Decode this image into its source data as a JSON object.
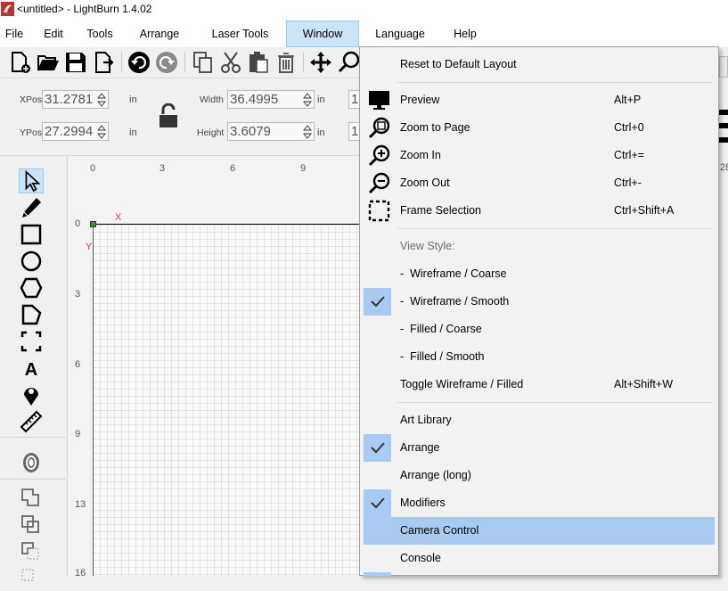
{
  "window": {
    "title": "<untitled> - LightBurn 1.4.02",
    "icon": "lightburn-logo-icon"
  },
  "menubar": {
    "items": [
      {
        "label": "File"
      },
      {
        "label": "Edit"
      },
      {
        "label": "Tools"
      },
      {
        "label": "Arrange"
      },
      {
        "label": "Laser Tools"
      },
      {
        "label": "Window",
        "active": true
      },
      {
        "label": "Language"
      },
      {
        "label": "Help"
      }
    ]
  },
  "toolbar": {
    "icons": [
      "new-file-icon",
      "open-folder-icon",
      "save-icon",
      "import-icon",
      "undo-icon",
      "redo-icon",
      "copy-icon",
      "cut-icon",
      "paste-icon",
      "delete-icon",
      "move-icon",
      "zoom-icon"
    ]
  },
  "numeric": {
    "xpos_label": "XPos",
    "xpos_value": "31.2781",
    "ypos_label": "YPos",
    "ypos_value": "27.2994",
    "width_label": "Width",
    "width_value": "36.4995",
    "height_label": "Height",
    "height_value": "3.6079",
    "unit": "in",
    "partial_1": "1",
    "partial_2": "1"
  },
  "ruler": {
    "x_ticks": [
      "0",
      "3",
      "6",
      "9"
    ],
    "y_ticks": [
      "0",
      "3",
      "6",
      "9",
      "13",
      "16"
    ],
    "right_partial": "28",
    "axis_x": "X",
    "axis_y": "Y"
  },
  "tools": [
    "select-icon",
    "edit-nodes-icon",
    "rectangle-icon",
    "ellipse-icon",
    "polygon-icon",
    "pentagon-icon",
    "frame-icon",
    "text-icon",
    "position-laser-icon",
    "measure-icon",
    "offset-icon",
    "weld-icon",
    "union-icon",
    "subtract-icon",
    "intersect-icon"
  ],
  "window_menu": {
    "items": [
      {
        "label": "Reset to Default Layout",
        "shortcut": ""
      },
      {
        "label": "Preview",
        "shortcut": "Alt+P",
        "icon": "monitor-icon"
      },
      {
        "label": "Zoom to Page",
        "shortcut": "Ctrl+0",
        "icon": "zoom-to-page-icon"
      },
      {
        "label": "Zoom In",
        "shortcut": "Ctrl+=",
        "icon": "zoom-in-icon"
      },
      {
        "label": "Zoom Out",
        "shortcut": "Ctrl+-",
        "icon": "zoom-out-icon"
      },
      {
        "label": "Frame Selection",
        "shortcut": "Ctrl+Shift+A",
        "icon": "frame-selection-icon"
      },
      {
        "label": "View Style:",
        "disabled": true
      },
      {
        "label": "-  Wireframe / Coarse"
      },
      {
        "label": "-  Wireframe / Smooth",
        "checked": true
      },
      {
        "label": "-  Filled / Coarse"
      },
      {
        "label": "-  Filled / Smooth"
      },
      {
        "label": "Toggle Wireframe / Filled",
        "shortcut": "Alt+Shift+W"
      },
      {
        "label": "Art Library"
      },
      {
        "label": "Arrange",
        "checked": true
      },
      {
        "label": "Arrange (long)"
      },
      {
        "label": "Modifiers",
        "checked": true
      },
      {
        "label": "Camera Control",
        "highlighted": true
      },
      {
        "label": "Console"
      }
    ]
  },
  "colors": {
    "menu_highlight": "#aacbf1",
    "menu_active": "#cce4f7",
    "check_bg": "#aacbf1"
  }
}
